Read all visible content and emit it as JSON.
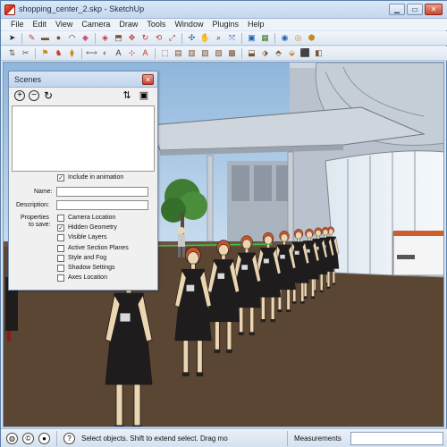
{
  "window": {
    "title": "shopping_center_2.skp - SketchUp"
  },
  "menu": [
    "File",
    "Edit",
    "View",
    "Camera",
    "Draw",
    "Tools",
    "Window",
    "Plugins",
    "Help"
  ],
  "toolbar_row1": [
    {
      "icon": "select-arrow-icon",
      "glyph": "➤",
      "color": "#222"
    },
    {
      "icon": "line-pencil-icon",
      "glyph": "✎",
      "color": "#c0392b"
    },
    {
      "icon": "rectangle-icon",
      "glyph": "▬",
      "color": "#7a5230"
    },
    {
      "icon": "circle-icon",
      "glyph": "●",
      "color": "#7a5230"
    },
    {
      "icon": "arc-icon",
      "glyph": "◠",
      "color": "#333"
    },
    {
      "icon": "eraser-icon",
      "glyph": "◆",
      "color": "#d1557a"
    },
    {
      "icon": "paint-bucket-icon",
      "glyph": "◈",
      "color": "#c0392b"
    },
    {
      "icon": "push-pull-icon",
      "glyph": "⬒",
      "color": "#7a5230"
    },
    {
      "icon": "move-icon",
      "glyph": "✥",
      "color": "#c0392b"
    },
    {
      "icon": "rotate-icon",
      "glyph": "↻",
      "color": "#c0392b"
    },
    {
      "icon": "follow-me-icon",
      "glyph": "⟲",
      "color": "#c0392b"
    },
    {
      "icon": "scale-icon",
      "glyph": "⤢",
      "color": "#c0392b"
    },
    {
      "icon": "orbit-icon",
      "glyph": "✣",
      "color": "#1f5fae"
    },
    {
      "icon": "pan-icon",
      "glyph": "✋",
      "color": "#8a6d3b"
    },
    {
      "icon": "zoom-icon",
      "glyph": "⌕",
      "color": "#333"
    },
    {
      "icon": "zoom-extents-icon",
      "glyph": "⤧",
      "color": "#1f5fae"
    },
    {
      "icon": "components-icon",
      "glyph": "▣",
      "color": "#1f5fae"
    },
    {
      "icon": "get-models-icon",
      "glyph": "▦",
      "color": "#3a7a2a"
    },
    {
      "icon": "materials-icon",
      "glyph": "◉",
      "color": "#1f5fae"
    },
    {
      "icon": "share-model-icon",
      "glyph": "◎",
      "color": "#c48a1a"
    },
    {
      "icon": "photo-textures-icon",
      "glyph": "⬢",
      "color": "#c48a1a"
    }
  ],
  "toolbar_row2": [
    {
      "icon": "walk-icon",
      "glyph": "⇅",
      "color": "#555"
    },
    {
      "icon": "look-around-icon",
      "glyph": "✂",
      "color": "#555"
    },
    {
      "icon": "section-plane-icon",
      "glyph": "⚑",
      "color": "#c48a1a"
    },
    {
      "icon": "position-camera-icon",
      "glyph": "♞",
      "color": "#c0392b"
    },
    {
      "icon": "tape-measure-icon",
      "glyph": "⧫",
      "color": "#c48a1a"
    },
    {
      "icon": "dimension-icon",
      "glyph": "⟷",
      "color": "#777"
    },
    {
      "icon": "protractor-icon",
      "glyph": "◐",
      "color": "#777"
    },
    {
      "icon": "text-tool-icon",
      "glyph": "A",
      "color": "#333"
    },
    {
      "icon": "axes-icon",
      "glyph": "⊹",
      "color": "#c0392b"
    },
    {
      "icon": "3d-text-icon",
      "glyph": "A",
      "color": "#c0392b"
    },
    {
      "icon": "iso-view-icon",
      "glyph": "⬚",
      "color": "#7a5230"
    },
    {
      "icon": "top-view-icon",
      "glyph": "▤",
      "color": "#7a5230"
    },
    {
      "icon": "front-view-icon",
      "glyph": "▥",
      "color": "#7a5230"
    },
    {
      "icon": "right-view-icon",
      "glyph": "▧",
      "color": "#7a5230"
    },
    {
      "icon": "back-view-icon",
      "glyph": "▨",
      "color": "#7a5230"
    },
    {
      "icon": "left-view-icon",
      "glyph": "▩",
      "color": "#7a5230"
    },
    {
      "icon": "xray-icon",
      "glyph": "⬓",
      "color": "#7a5230"
    },
    {
      "icon": "wireframe-icon",
      "glyph": "⬗",
      "color": "#7a5230"
    },
    {
      "icon": "hidden-line-icon",
      "glyph": "⬘",
      "color": "#7a5230"
    },
    {
      "icon": "shaded-icon",
      "glyph": "⬙",
      "color": "#c48a1a"
    },
    {
      "icon": "shaded-textures-icon",
      "glyph": "⬛",
      "color": "#7a5230"
    },
    {
      "icon": "monochrome-icon",
      "glyph": "◧",
      "color": "#7a5230"
    }
  ],
  "scenes_panel": {
    "title": "Scenes",
    "close_glyph": "✕",
    "add_glyph": "+",
    "remove_glyph": "−",
    "update_glyph": "↻",
    "up_glyph": "⇅",
    "details_glyph": "▣",
    "include_in_animation": {
      "label": "Include in animation",
      "checked": true
    },
    "name_label": "Name:",
    "name_value": "",
    "description_label": "Description:",
    "description_value": "",
    "properties_label_line1": "Properties",
    "properties_label_line2": "to save:",
    "properties": [
      {
        "label": "Camera Location",
        "checked": false
      },
      {
        "label": "Hidden Geometry",
        "checked": true
      },
      {
        "label": "Visible Layers",
        "checked": false
      },
      {
        "label": "Active Section Planes",
        "checked": false
      },
      {
        "label": "Style and Fog",
        "checked": false
      },
      {
        "label": "Shadow Settings",
        "checked": false
      },
      {
        "label": "Axes Location",
        "checked": false
      }
    ]
  },
  "status": {
    "message": "Select objects. Shift to extend select. Drag mo",
    "measurements_label": "Measurements",
    "measurements_value": "",
    "icons": [
      "geo-location-icon",
      "credits-icon",
      "user-icon",
      "help-icon"
    ]
  },
  "colors": {
    "sky": "#a9c7e3",
    "ground": "#5b4533",
    "building": "#b9c2cd",
    "dress": "#1e1c1c",
    "skin": "#ecd6b2",
    "hair": "#c5532b"
  }
}
